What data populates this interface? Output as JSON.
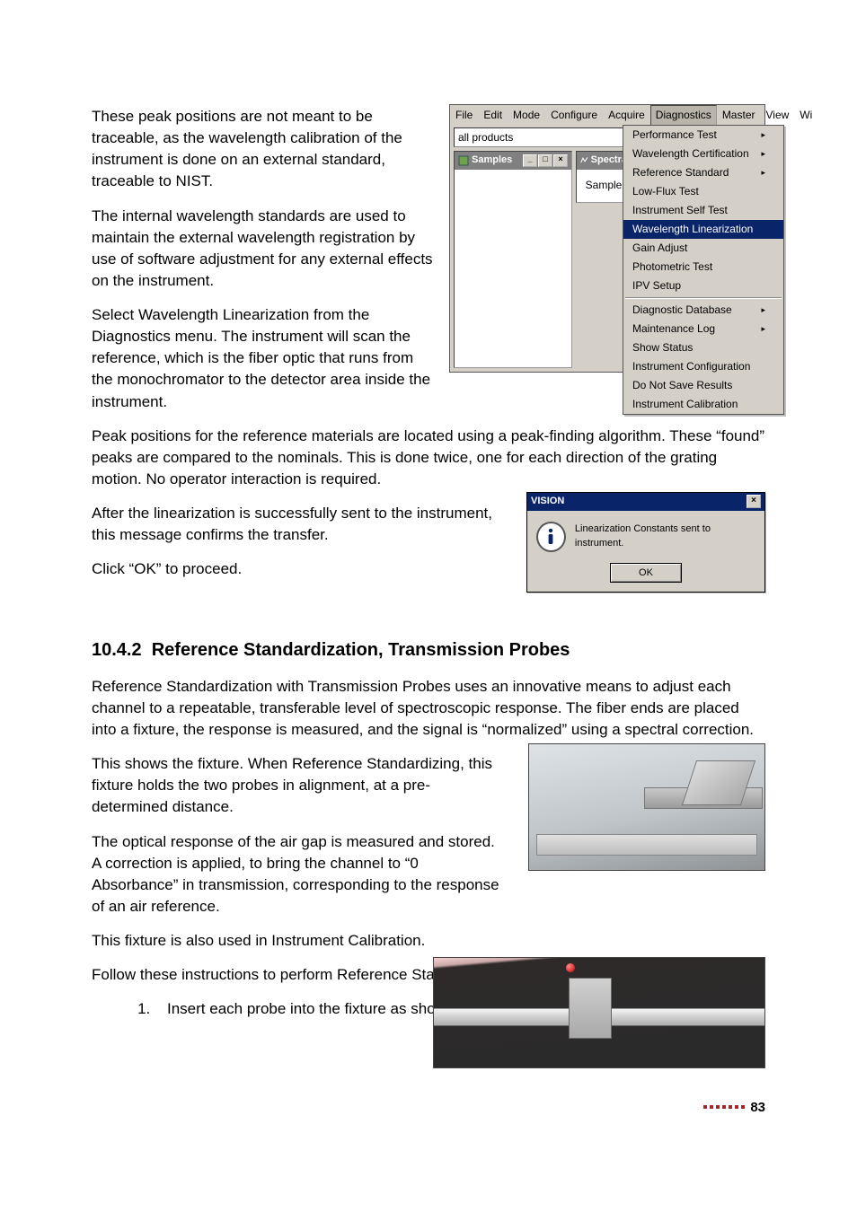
{
  "para1": "These peak positions are not meant to be traceable, as the wavelength calibration of the instrument is done on an external standard, traceable to NIST.",
  "para2": "The internal wavelength standards are used to maintain the external wavelength registration by use of software adjustment for any external effects on the instrument.",
  "para3": "Select Wavelength Linearization from the Diagnostics menu. The instrument will scan the reference, which is the fiber optic that runs from the monochromator to the detector area inside the instrument.",
  "para4": "Peak positions for the reference materials are located using a peak-finding algorithm. These “found” peaks are compared to the nominals. This is done twice, one for each direction of the grating motion. No operator interaction is required.",
  "para5": "After the linearization is successfully sent to the instrument, this message confirms the transfer.",
  "para6": "Click “OK” to proceed.",
  "section_no": "10.4.2",
  "section_title": "Reference Standardization, Transmission Probes",
  "para7": "Reference Standardization with Transmission Probes uses an innovative means to adjust each channel to a repeatable, transferable level of spectroscopic response. The fiber ends are placed into a fixture, the response is measured, and the signal is “normalized” using a spectral correction.",
  "para8": "This shows the fixture. When Reference Standardizing, this fixture holds the two probes in alignment, at a pre-determined distance.",
  "para9": "The optical response of the air gap is measured and stored. A correction is applied, to bring the channel to “0 Absorbance” in transmission, corresponding to the response of an air reference.",
  "para10": "This fixture is also used in Instrument Calibration.",
  "para11": "Follow these instructions to perform Reference Standardization:",
  "step1": "Insert each probe into the fixture as shown.",
  "menubar": [
    "File",
    "Edit",
    "Mode",
    "Configure",
    "Acquire",
    "Diagnostics",
    "Master",
    "View",
    "Wi"
  ],
  "combo_value": "all products",
  "panel1_title": "Samples",
  "panel2_title": "Spectra",
  "panel2_tab": "Sample",
  "diagnostics_menu": {
    "group1": [
      {
        "label": "Performance Test",
        "arrow": true
      },
      {
        "label": "Wavelength Certification",
        "arrow": true
      },
      {
        "label": "Reference Standard",
        "arrow": true
      },
      {
        "label": "Low-Flux Test",
        "arrow": false
      },
      {
        "label": "Instrument Self Test",
        "arrow": false
      }
    ],
    "highlight": {
      "label": "Wavelength Linearization",
      "arrow": false
    },
    "group1b": [
      {
        "label": "Gain Adjust",
        "arrow": false
      },
      {
        "label": "Photometric Test",
        "arrow": false
      },
      {
        "label": "IPV Setup",
        "arrow": false
      }
    ],
    "group2": [
      {
        "label": "Diagnostic Database",
        "arrow": true
      },
      {
        "label": "Maintenance Log",
        "arrow": true
      },
      {
        "label": "Show Status",
        "arrow": false
      },
      {
        "label": "Instrument Configuration",
        "arrow": false
      },
      {
        "label": "Do Not Save Results",
        "arrow": false
      },
      {
        "label": "Instrument Calibration",
        "arrow": false
      }
    ]
  },
  "dialog": {
    "title": "VISION",
    "message": "Linearization Constants sent to instrument.",
    "ok": "OK"
  },
  "page_number": "83"
}
